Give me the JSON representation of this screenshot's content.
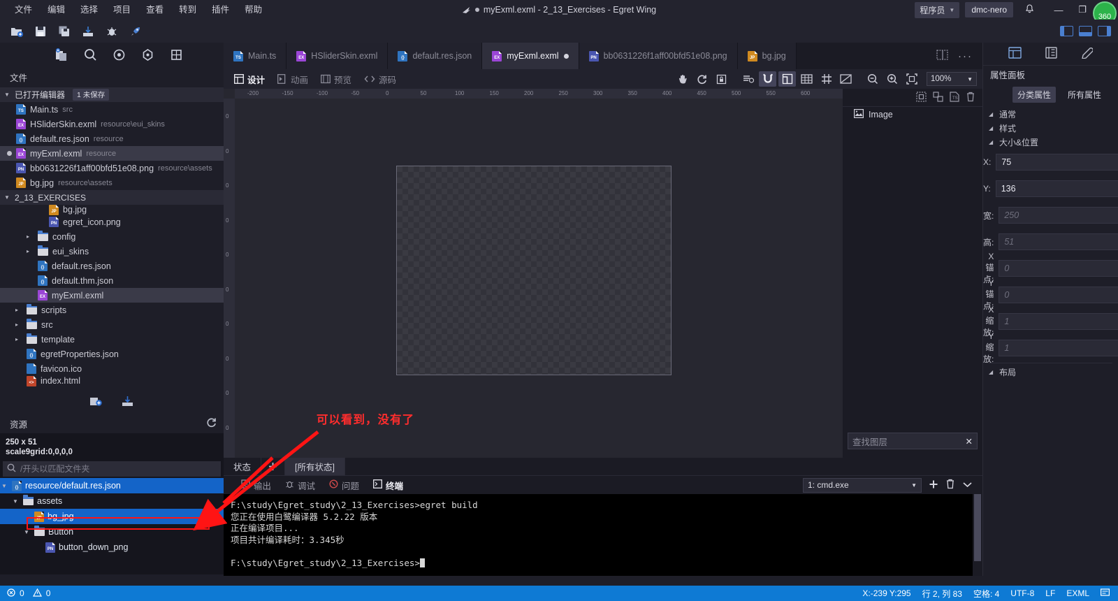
{
  "titlebar": {
    "menu": [
      "文件",
      "编辑",
      "选择",
      "项目",
      "查看",
      "转到",
      "插件",
      "帮助"
    ],
    "title": "myExml.exml - 2_13_Exercises - Egret Wing",
    "role": "程序员",
    "user": "dmc-nero",
    "badge": "360",
    "minimize": "—",
    "maximize": "❐",
    "close": "✕"
  },
  "activity": {
    "items": [
      "layers-icon",
      "search-icon",
      "debug-icon",
      "extension-icon",
      "plugin-icon"
    ]
  },
  "filepanel": {
    "header": "文件",
    "open_editors": {
      "label": "已打开编辑器",
      "badge": "1 未保存"
    },
    "open_files": [
      {
        "name": "Main.ts",
        "meta": "src",
        "type": "ts",
        "dirty": false,
        "selected": false
      },
      {
        "name": "HSliderSkin.exml",
        "meta": "resource\\eui_skins",
        "type": "exml",
        "dirty": false,
        "selected": false
      },
      {
        "name": "default.res.json",
        "meta": "resource",
        "type": "json",
        "dirty": false,
        "selected": false
      },
      {
        "name": "myExml.exml",
        "meta": "resource",
        "type": "exml",
        "dirty": true,
        "selected": true
      },
      {
        "name": "bb0631226f1aff00bfd51e08.png",
        "meta": "resource\\assets",
        "type": "png",
        "dirty": false,
        "selected": false
      },
      {
        "name": "bg.jpg",
        "meta": "resource\\assets",
        "type": "jpg",
        "dirty": false,
        "selected": false
      }
    ],
    "project_root": "2_13_EXERCISES",
    "tree": [
      {
        "name": "bg.jpg",
        "type": "jpg",
        "indent": 3,
        "kind": "file",
        "clipped": true
      },
      {
        "name": "egret_icon.png",
        "type": "png",
        "indent": 3,
        "kind": "file"
      },
      {
        "name": "config",
        "type": "folder",
        "indent": 2,
        "kind": "folder"
      },
      {
        "name": "eui_skins",
        "type": "folder",
        "indent": 2,
        "kind": "folder"
      },
      {
        "name": "default.res.json",
        "type": "json",
        "indent": 2,
        "kind": "file"
      },
      {
        "name": "default.thm.json",
        "type": "json",
        "indent": 2,
        "kind": "file"
      },
      {
        "name": "myExml.exml",
        "type": "exml",
        "indent": 2,
        "kind": "file",
        "selected": true
      },
      {
        "name": "scripts",
        "type": "folder",
        "indent": 1,
        "kind": "folder"
      },
      {
        "name": "src",
        "type": "folder",
        "indent": 1,
        "kind": "folder"
      },
      {
        "name": "template",
        "type": "folder",
        "indent": 1,
        "kind": "folder"
      },
      {
        "name": "egretProperties.json",
        "type": "json",
        "indent": 1,
        "kind": "file"
      },
      {
        "name": "favicon.ico",
        "type": "ico",
        "indent": 1,
        "kind": "file"
      },
      {
        "name": "index.html",
        "type": "html",
        "indent": 1,
        "kind": "file",
        "clipped": true
      }
    ]
  },
  "respanel": {
    "header": "资源",
    "refresh_icon": "refresh-icon",
    "size_info": "250 x 51",
    "scale9_info": "scale9grid:0,0,0,0",
    "search_placeholder": "/开头以匹配文件夹",
    "tree": [
      {
        "name": "resource/default.res.json",
        "type": "json",
        "indent": 0,
        "highlight": true,
        "expanded": true
      },
      {
        "name": "assets",
        "type": "folder",
        "indent": 1,
        "highlight": false,
        "expanded": true
      },
      {
        "name": "bg_jpg",
        "type": "jpg",
        "indent": 2,
        "highlight": true,
        "expanded": false
      },
      {
        "name": "Button",
        "type": "folder",
        "indent": 2,
        "highlight": false,
        "expanded": true
      },
      {
        "name": "button_down_png",
        "type": "png",
        "indent": 3,
        "highlight": false,
        "expanded": false
      }
    ]
  },
  "tabs": [
    {
      "label": "Main.ts",
      "type": "ts",
      "active": false,
      "dirty": false
    },
    {
      "label": "HSliderSkin.exml",
      "type": "exml",
      "active": false,
      "dirty": false
    },
    {
      "label": "default.res.json",
      "type": "json",
      "active": false,
      "dirty": false
    },
    {
      "label": "myExml.exml",
      "type": "exml",
      "active": true,
      "dirty": true
    },
    {
      "label": "bb0631226f1aff00bfd51e08.png",
      "type": "png",
      "active": false,
      "dirty": false
    },
    {
      "label": "bg.jpg",
      "type": "jpg",
      "active": false,
      "dirty": false
    }
  ],
  "tabbar_right": {
    "split_icon": "split-editor-icon",
    "more_icon": "more-actions-icon"
  },
  "designbar": {
    "view_tabs": [
      {
        "label": "设计",
        "active": true,
        "icon": "design-icon"
      },
      {
        "label": "动画",
        "active": false,
        "icon": "animation-icon"
      },
      {
        "label": "预览",
        "active": false,
        "icon": "preview-icon"
      },
      {
        "label": "源码",
        "active": false,
        "icon": "code-icon"
      }
    ],
    "tools": [
      {
        "name": "hand-tool-icon",
        "active": false
      },
      {
        "name": "refresh-icon",
        "active": false
      },
      {
        "name": "lock-frame-icon",
        "active": false
      },
      {
        "name": "layers-order-icon",
        "active": false
      },
      {
        "name": "magnet-snap-icon",
        "active": true
      },
      {
        "name": "align-edge-icon",
        "active": true
      },
      {
        "name": "grid-icon",
        "active": false
      },
      {
        "name": "guides-icon",
        "active": false
      },
      {
        "name": "ruler-toggle-icon",
        "active": false
      }
    ],
    "zoom_out_icon": "zoom-out-icon",
    "zoom_in_icon": "zoom-in-icon",
    "fit_icon": "fit-to-screen-icon",
    "zoom_value": "100%"
  },
  "canvas": {
    "ruler_h_ticks": [
      "-200",
      "-150",
      "-100",
      "-50",
      "0",
      "50",
      "100",
      "150",
      "200",
      "250",
      "300",
      "350",
      "400",
      "450",
      "500",
      "550",
      "600"
    ],
    "ruler_v_ticks": [
      "0",
      "0",
      "0",
      "0",
      "0",
      "0",
      "0",
      "0",
      "0",
      "0",
      "0"
    ],
    "annotation": "可以看到，没有了"
  },
  "layerpanel": {
    "tools": [
      "select-all-icon",
      "group-icon",
      "create-ts-icon",
      "delete-icon"
    ],
    "layers": [
      {
        "name": "Image",
        "icon": "image-icon"
      }
    ],
    "search_placeholder": "查找图层",
    "search_clear": "✕"
  },
  "proppanel": {
    "header_icons": [
      "properties-icon",
      "library-icon",
      "style-icon"
    ],
    "title": "属性面板",
    "segments": [
      {
        "label": "分类属性",
        "active": true
      },
      {
        "label": "所有属性",
        "active": false
      }
    ],
    "groups": [
      {
        "label": "通常",
        "expanded": true
      },
      {
        "label": "样式",
        "expanded": true
      },
      {
        "label": "大小&位置",
        "expanded": true
      }
    ],
    "fields": [
      {
        "label": "X:",
        "value": "75",
        "placeholder": ""
      },
      {
        "label": "Y:",
        "value": "136",
        "placeholder": ""
      },
      {
        "label": "宽:",
        "value": "",
        "placeholder": "250"
      },
      {
        "label": "高:",
        "value": "",
        "placeholder": "51"
      },
      {
        "label": "X锚点:",
        "value": "",
        "placeholder": "0"
      },
      {
        "label": "Y锚点:",
        "value": "",
        "placeholder": "0"
      },
      {
        "label": "X缩放:",
        "value": "",
        "placeholder": "1"
      },
      {
        "label": "Y缩放:",
        "value": "",
        "placeholder": "1"
      }
    ],
    "layout_group": "布局"
  },
  "console": {
    "state_tabs": [
      {
        "label": "状态",
        "active": false
      },
      {
        "label": "[所有状态]",
        "active": true
      }
    ],
    "add_state_icon": "add-state-icon",
    "tabs": [
      {
        "label": "输出",
        "active": false,
        "icon": "output-icon"
      },
      {
        "label": "调试",
        "active": false,
        "icon": "debug-icon"
      },
      {
        "label": "问题",
        "active": false,
        "icon": "problems-icon"
      },
      {
        "label": "终端",
        "active": true,
        "icon": "terminal-icon"
      }
    ],
    "terminal_select": "1: cmd.exe",
    "add_terminal_icon": "add-icon",
    "kill_terminal_icon": "trash-icon",
    "chevron_icon": "chevron-down-icon",
    "terminal_lines": [
      "F:\\study\\Egret_study\\2_13_Exercises>egret build",
      "您正在使用白鹭编译器 5.2.22 版本",
      "正在编译项目...",
      "项目共计编译耗时：3.345秒",
      "",
      "F:\\study\\Egret_study\\2_13_Exercises>"
    ]
  },
  "statusbar": {
    "errors": "0",
    "warnings": "0",
    "coords": "X:-239 Y:295",
    "cursor": "行 2, 列 83",
    "spaces": "空格: 4",
    "encoding": "UTF-8",
    "eol": "LF",
    "language": "EXML",
    "bell_icon": "notifications-icon"
  }
}
